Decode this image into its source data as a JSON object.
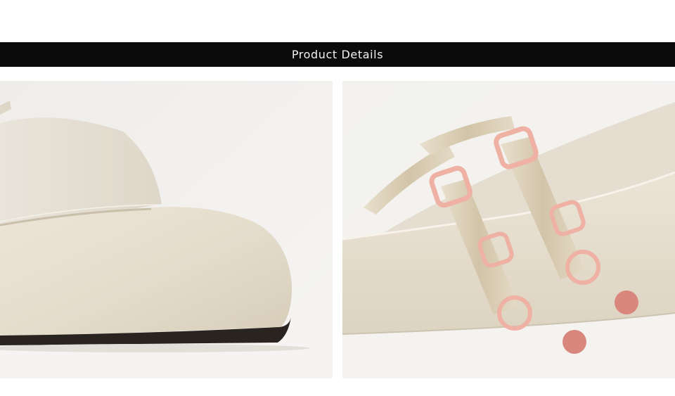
{
  "banner": {
    "title": "Product Details"
  },
  "photos": [
    {
      "subject": "shoe-toe-closeup"
    },
    {
      "subject": "shoe-strap-buckle-closeup"
    }
  ],
  "colors": {
    "banner_bg": "#0b0b0b",
    "banner_text": "#f2f2f2",
    "leather": "#e6dfd1",
    "strap": "#d8ccb4",
    "buckle": "#efb1a4",
    "pompom": "#d9877c"
  }
}
